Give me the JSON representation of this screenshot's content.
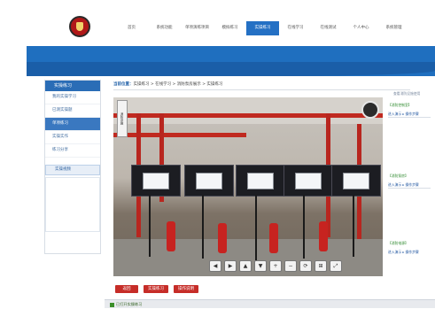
{
  "nav": {
    "items": [
      "首页",
      "系统功能",
      "单项演练项目",
      "模拟练习",
      "实操练习",
      "在线学习",
      "在线测试",
      "个人中心",
      "系统管理"
    ],
    "active_index": 4
  },
  "sidebar": {
    "title": "实操练习",
    "items": [
      "我的实操学习",
      "已测实操题",
      "单项练习",
      "实操实作",
      "练习分享"
    ],
    "selected_index": 2,
    "section_title": "实操视频"
  },
  "breadcrumb": {
    "current_label": "当前位置：",
    "path": "实操练习 > 在线学习 > 消防泵房展示 > 实操练习"
  },
  "top_link": "查看消防设施使用",
  "viewer": {
    "side_tag": "消防设施",
    "controls": [
      "◀",
      "▶",
      "▲",
      "▼",
      "+",
      "−",
      "⟳",
      "⊞",
      "⤢"
    ]
  },
  "right_panel": [
    {
      "title": "【消防控制室】",
      "link": "进入演示 ▸ 操作步骤"
    },
    {
      "title": "【消防泵房】",
      "link": "进入演示 ▸ 操作步骤"
    },
    {
      "title": "【消防电源】",
      "link": "进入演示 ▸ 操作步骤"
    }
  ],
  "buttons": [
    "返回",
    "实操练习",
    "操作说明"
  ],
  "status": "已打开实操练习"
}
